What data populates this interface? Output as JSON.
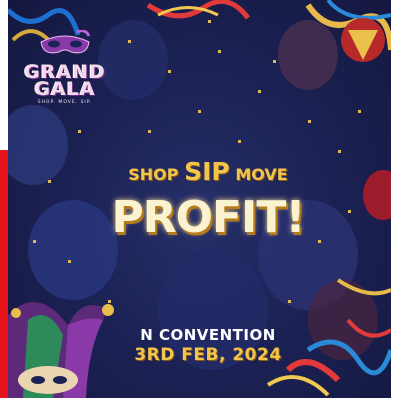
{
  "logo": {
    "title_line1": "GRAND",
    "title_line2": "GALA",
    "tagline": "SHOP. MOVE. SIP."
  },
  "headline": {
    "word_shop": "SHOP",
    "word_sip": "SIP",
    "word_move": "MOVE",
    "main": "PROFIT!"
  },
  "event": {
    "venue": "N CONVENTION",
    "date": "3RD FEB, 2024"
  },
  "colors": {
    "background": "#1c2255",
    "gold": "#f4c54d",
    "cream": "#fbf2d0",
    "accent_purple": "#7b3a8c",
    "side_bar": "#e8141c"
  },
  "icons": [
    "masquerade-mask-icon",
    "jester-hat-icon",
    "party-streamer-icon",
    "balloon-icon",
    "confetti-icon"
  ]
}
